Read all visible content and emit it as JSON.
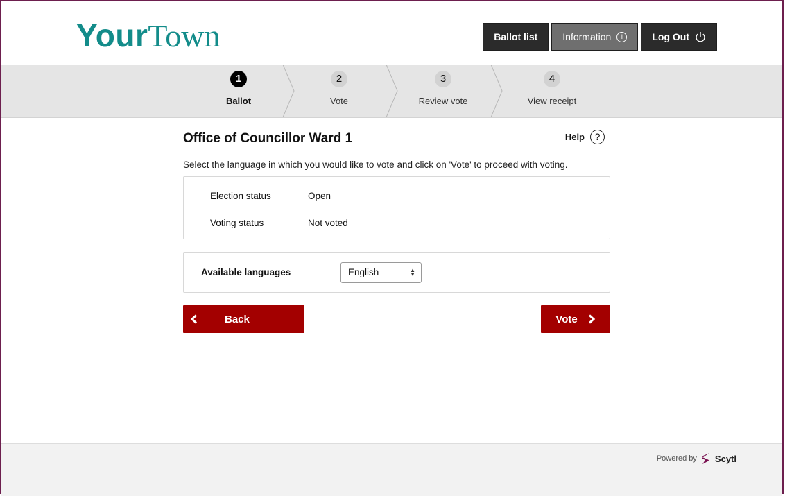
{
  "header": {
    "logo_part1": "Your",
    "logo_part2": "Town",
    "nav": {
      "ballot_list": "Ballot list",
      "information": "Information",
      "logout": "Log Out"
    }
  },
  "steps": [
    {
      "number": "1",
      "label": "Ballot",
      "active": true
    },
    {
      "number": "2",
      "label": "Vote",
      "active": false
    },
    {
      "number": "3",
      "label": "Review vote",
      "active": false
    },
    {
      "number": "4",
      "label": "View receipt",
      "active": false
    }
  ],
  "main": {
    "title": "Office of Councillor Ward 1",
    "help_label": "Help",
    "instruction": "Select the language in which you would like to vote and click on 'Vote' to proceed with voting.",
    "status": {
      "election_label": "Election status",
      "election_value": "Open",
      "voting_label": "Voting status",
      "voting_value": "Not voted"
    },
    "languages": {
      "label": "Available languages",
      "selected": "English"
    },
    "back_label": "Back",
    "vote_label": "Vote"
  },
  "footer": {
    "powered_by": "Powered by",
    "brand": "Scytl"
  },
  "colors": {
    "accent_red": "#a30000",
    "logo_teal": "#138c8a",
    "frame_border": "#6d1f4e"
  },
  "icons": [
    "info-icon",
    "power-icon",
    "help-icon",
    "chevron-left-icon",
    "chevron-right-icon",
    "select-updown-icon",
    "scytl-logo-icon"
  ]
}
